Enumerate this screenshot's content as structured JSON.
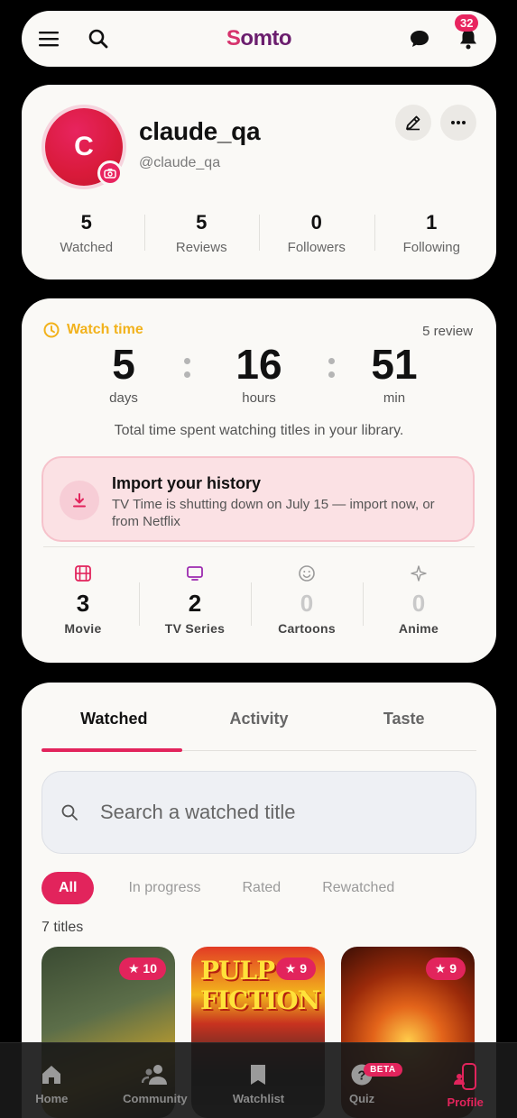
{
  "header": {
    "logo_s": "S",
    "logo_rest": "omto",
    "notification_count": "32"
  },
  "profile": {
    "avatar_initial": "C",
    "username": "claude_qa",
    "handle": "@claude_qa",
    "stats": [
      {
        "value": "5",
        "label": "Watched"
      },
      {
        "value": "5",
        "label": "Reviews"
      },
      {
        "value": "0",
        "label": "Followers"
      },
      {
        "value": "1",
        "label": "Following"
      }
    ]
  },
  "watch_time": {
    "label": "Watch time",
    "review_count": "5 review",
    "days": "5",
    "days_label": "days",
    "hours": "16",
    "hours_label": "hours",
    "minutes": "51",
    "minutes_label": "min",
    "description": "Total time spent watching titles in your library.",
    "import": {
      "title": "Import your history",
      "text": "TV Time is shutting down on July 15 — import now, or from Netflix"
    },
    "categories": [
      {
        "icon": "film-icon",
        "value": "3",
        "label": "Movie"
      },
      {
        "icon": "tv-icon",
        "value": "2",
        "label": "TV Series"
      },
      {
        "icon": "smiley-icon",
        "value": "0",
        "label": "Cartoons"
      },
      {
        "icon": "sparkle-icon",
        "value": "0",
        "label": "Anime"
      }
    ]
  },
  "library": {
    "tabs": [
      "Watched",
      "Activity",
      "Taste"
    ],
    "search_placeholder": "Search a watched title",
    "filters": [
      "All",
      "In progress",
      "Rated",
      "Rewatched"
    ],
    "count_text": "7 titles",
    "posters": [
      {
        "rating": "10",
        "title_art": ""
      },
      {
        "rating": "9",
        "title_art": "PULP FICTION"
      },
      {
        "rating": "9",
        "title_art": ""
      }
    ]
  },
  "bottom_nav": [
    {
      "label": "Home",
      "icon": "home-icon"
    },
    {
      "label": "Community",
      "icon": "community-icon"
    },
    {
      "label": "Watchlist",
      "icon": "bookmark-icon"
    },
    {
      "label": "Quiz",
      "icon": "quiz-icon",
      "badge": "BETA"
    },
    {
      "label": "Profile",
      "icon": "profile-icon",
      "active": true
    }
  ],
  "colors": {
    "accent": "#e2245c",
    "watch_time": "#f2b21c",
    "card_bg": "#faf9f6"
  }
}
